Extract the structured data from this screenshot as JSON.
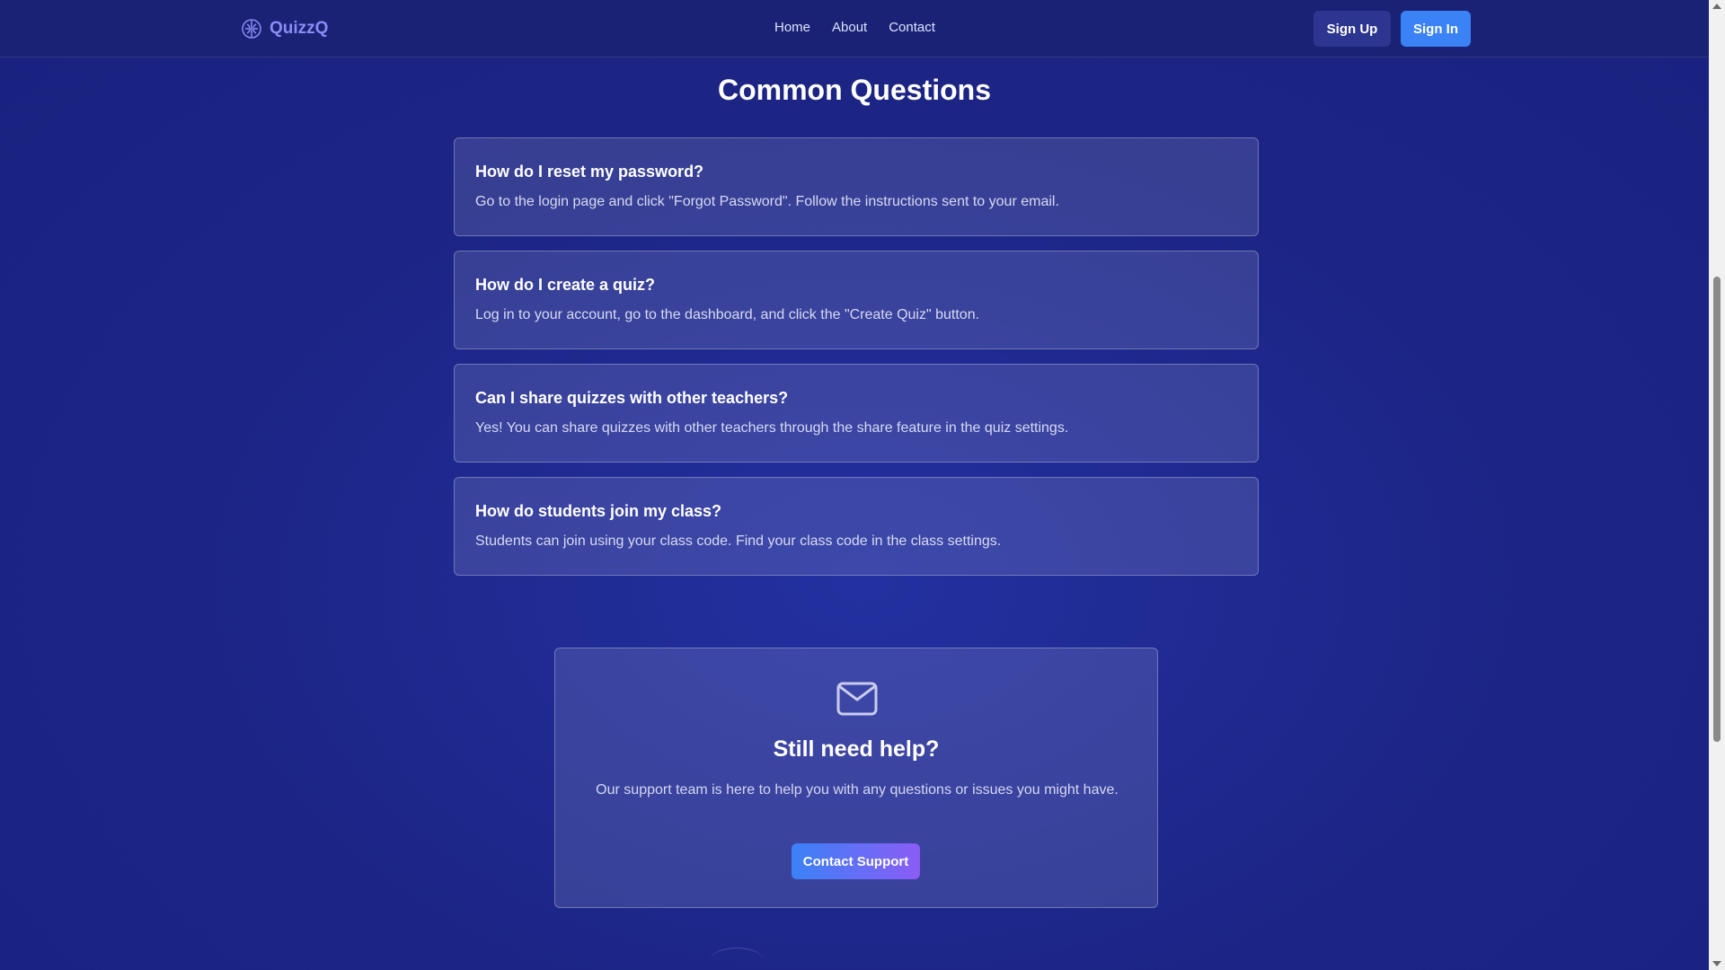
{
  "brand": {
    "name": "QuizzQ",
    "logo_icon": "brain-icon",
    "color": "#8a8cf5"
  },
  "nav": {
    "links": [
      "Home",
      "About",
      "Contact"
    ]
  },
  "header_actions": {
    "signup_label": "Sign Up",
    "signin_label": "Sign In",
    "signin_color": "#3b82f6"
  },
  "faq": {
    "title": "Common Questions",
    "items": [
      {
        "question": "How do I reset my password?",
        "answer": "Go to the login page and click \"Forgot Password\". Follow the instructions sent to your email."
      },
      {
        "question": "How do I create a quiz?",
        "answer": "Log in to your account, go to the dashboard, and click the \"Create Quiz\" button."
      },
      {
        "question": "Can I share quizzes with other teachers?",
        "answer": "Yes! You can share quizzes with other teachers through the share feature in the quiz settings."
      },
      {
        "question": "How do students join my class?",
        "answer": "Students can join using your class code. Find your class code in the class settings."
      }
    ]
  },
  "help": {
    "icon": "mail-icon",
    "title": "Still need help?",
    "text": "Our support team is here to help you with any questions or issues you might have.",
    "button_label": "Contact Support"
  },
  "colors": {
    "background": "#1c2585",
    "accent": "#3b82f6",
    "accent_secondary": "#8b5cf6"
  }
}
